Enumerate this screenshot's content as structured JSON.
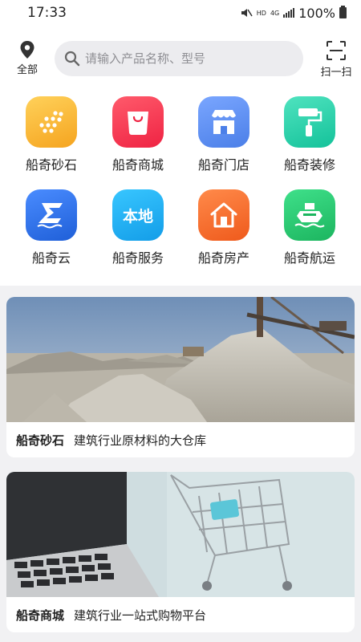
{
  "status": {
    "time": "17:33",
    "network": "4G",
    "hd": "HD",
    "battery": "100%"
  },
  "header": {
    "location_label": "全部",
    "search_placeholder": "请输入产品名称、型号",
    "scan_label": "扫一扫"
  },
  "grid": [
    {
      "label": "船奇砂石",
      "icon": "gravel-dots-icon",
      "color": "#f7b12c"
    },
    {
      "label": "船奇商城",
      "icon": "shopping-bag-icon",
      "color": "#f2364f"
    },
    {
      "label": "船奇门店",
      "icon": "storefront-icon",
      "color": "#5b8ef2"
    },
    {
      "label": "船奇装修",
      "icon": "paint-roller-icon",
      "color": "#1ecfa8"
    },
    {
      "label": "船奇云",
      "icon": "cloud-logo-icon",
      "color": "#2d6fe8"
    },
    {
      "label": "船奇服务",
      "icon": "local-service-icon",
      "color": "#1eb1f0",
      "icon_text": "本地"
    },
    {
      "label": "船奇房产",
      "icon": "house-icon",
      "color": "#f56a2a"
    },
    {
      "label": "船奇航运",
      "icon": "ship-icon",
      "color": "#22c46c"
    }
  ],
  "cards": [
    {
      "title": "船奇砂石",
      "subtitle": "建筑行业原材料的大仓库"
    },
    {
      "title": "船奇商城",
      "subtitle": "建筑行业一站式购物平台"
    }
  ]
}
